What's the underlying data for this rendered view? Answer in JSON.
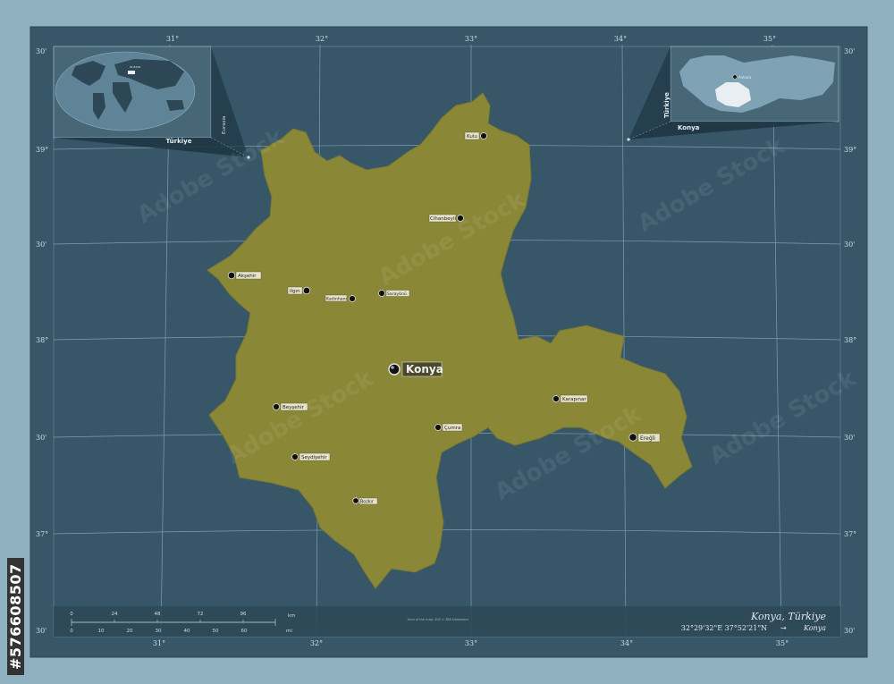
{
  "map": {
    "title": "Konya, Türkiye",
    "coordinates": "32°29'32\"E  37°52'21\"N",
    "coordinates_label": "Konya",
    "capital_label": "Konya",
    "cities": [
      "Kulu",
      "Cihanbeyli",
      "Akşehir",
      "Ilgın",
      "Kadınhanı",
      "Sarayönü",
      "Beyşehir",
      "Çumra",
      "Karapınar",
      "Ereğli",
      "Seydişehir",
      "Bozkır"
    ],
    "lon_ticks": [
      "31°",
      "32°",
      "33°",
      "34°",
      "35°"
    ],
    "lat_ticks": [
      "39°",
      "30'",
      "38°",
      "30'",
      "37°",
      "30'"
    ],
    "lat_ticks_small": [
      "30'"
    ],
    "inset_world_labels": {
      "country": "Türkiye",
      "region": "Eurasia",
      "ankara": "Ankara"
    },
    "inset_country_labels": {
      "country": "Türkiye",
      "province": "Konya",
      "capital": "Ankara"
    },
    "scale": {
      "km_ticks": [
        "0",
        "24",
        "48",
        "72",
        "96"
      ],
      "mi_ticks": [
        "0",
        "10",
        "20",
        "30",
        "40",
        "50",
        "60"
      ],
      "km_unit": "km",
      "mi_unit": "mi"
    },
    "footer_small": "Area of the map: 403 × 388 kilometers",
    "stock_id": "#576608507",
    "watermark": "Adobe Stock",
    "colors": {
      "frame": "#8fb0bf",
      "sea": "#375668",
      "land": "#8a8737",
      "inset_land": "#7fa2b4",
      "highlight": "#e8eef2"
    }
  }
}
